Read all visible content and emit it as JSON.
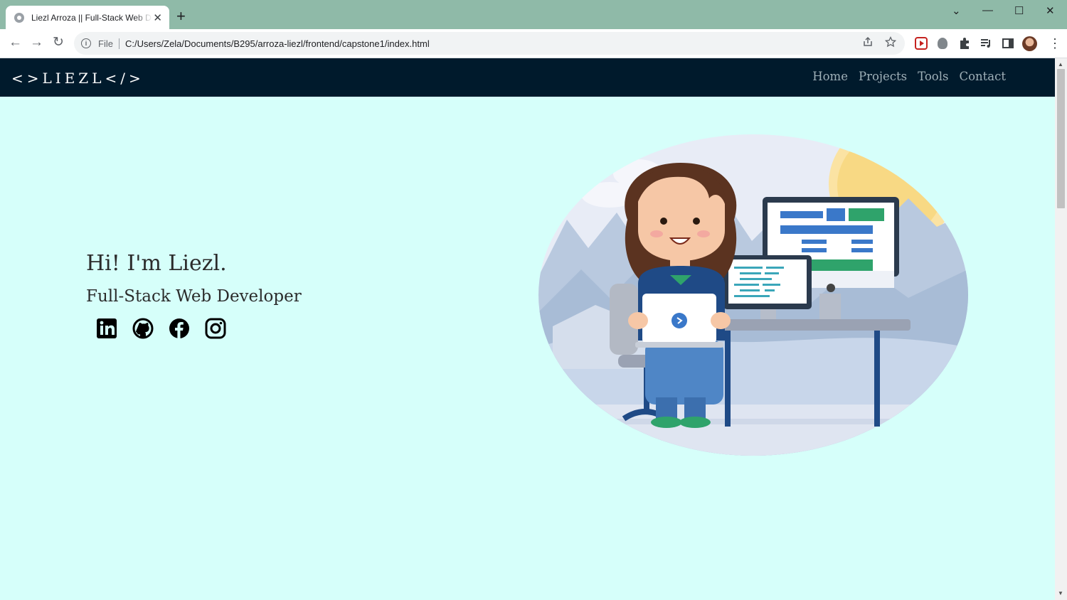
{
  "browser": {
    "tab_title": "Liezl Arroza || Full-Stack Web Developer",
    "tab_close": "✕",
    "new_tab": "+",
    "window_controls": {
      "dropdown": "⌄",
      "minimize": "—",
      "maximize": "☐",
      "close": "✕"
    },
    "nav": {
      "back": "←",
      "forward": "→",
      "reload": "↻"
    },
    "address": {
      "scheme_label": "File",
      "url": "C:/Users/Zela/Documents/B295/arroza-liezl/frontend/capstone1/index.html"
    },
    "omnibox_icons": [
      "share-icon",
      "star-icon"
    ],
    "extensions": [
      "video-extension-icon",
      "bug-extension-icon",
      "puzzle-extensions-icon",
      "media-queue-icon",
      "side-panel-icon"
    ],
    "menu": "⋮"
  },
  "site": {
    "logo": "<>LIEZL</>",
    "nav_links": [
      "Home",
      "Projects",
      "Tools",
      "Contact"
    ],
    "hero": {
      "greeting": "Hi! I'm Liezl.",
      "subtitle": "Full-Stack Web Developer"
    },
    "socials": [
      "linkedin-icon",
      "github-icon",
      "facebook-icon",
      "instagram-icon"
    ]
  },
  "colors": {
    "page_bg": "#d6fffa",
    "navbar_bg": "#001a2c",
    "nav_link": "#9fb0b8",
    "tabstrip": "#8fbaa8"
  }
}
